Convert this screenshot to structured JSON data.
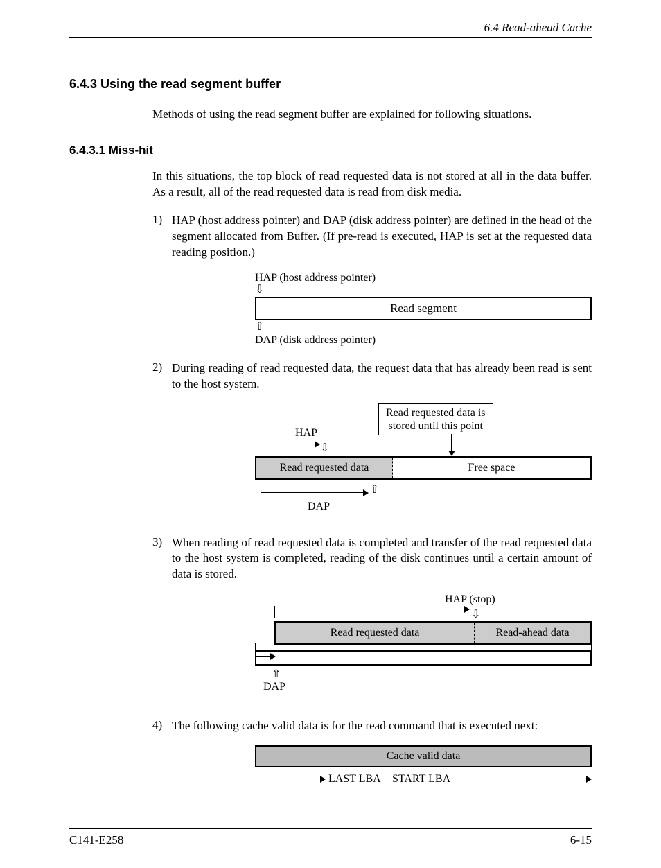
{
  "header": "6.4  Read-ahead Cache",
  "section_heading": "6.4.3  Using the read segment buffer",
  "intro_text": "Methods of using the read segment buffer are explained for following situations.",
  "subsection_heading": "6.4.3.1  Miss-hit",
  "miss_intro": "In this situations, the top block of read requested data is not stored at all in the data buffer.  As a result, all of the read requested data is read from disk media.",
  "item1_num": "1)",
  "item1_text": "HAP (host address pointer) and DAP (disk address pointer) are defined in the head of the segment allocated from Buffer.  (If pre-read is executed, HAP is set at the requested data reading position.)",
  "diag1": {
    "hap_label": "HAP (host address pointer)",
    "segment_label": "Read segment",
    "dap_label": "DAP (disk address pointer)",
    "arrow_down": "⇩",
    "arrow_up": "⇧"
  },
  "item2_num": "2)",
  "item2_text": "During reading of read requested data, the request data that has already been read is sent to the host system.",
  "diag2": {
    "callout_l1": "Read requested data is",
    "callout_l2": "stored until this point",
    "hap_label": "HAP",
    "hap_down": "⇩",
    "part_a": "Read requested data",
    "part_b": "Free space",
    "dap_up": "⇧",
    "dap_label": "DAP"
  },
  "item3_num": "3)",
  "item3_text": "When reading of read requested data is completed and transfer of the read requested data to the host system is completed, reading of the disk continues until a certain amount of data is stored.",
  "diag3": {
    "hap_label": "HAP (stop)",
    "hap_down": "⇩",
    "part_a": "Read requested data",
    "part_b": "Read-ahead data",
    "dap_up": "⇧",
    "dap_label": "DAP"
  },
  "item4_num": "4)",
  "item4_text": "The following cache valid data is for the read command that is executed next:",
  "diag4": {
    "bar_label": "Cache valid data",
    "last_lba": "LAST LBA",
    "start_lba": "START LBA"
  },
  "footer_left": "C141-E258",
  "footer_right": "6-15"
}
